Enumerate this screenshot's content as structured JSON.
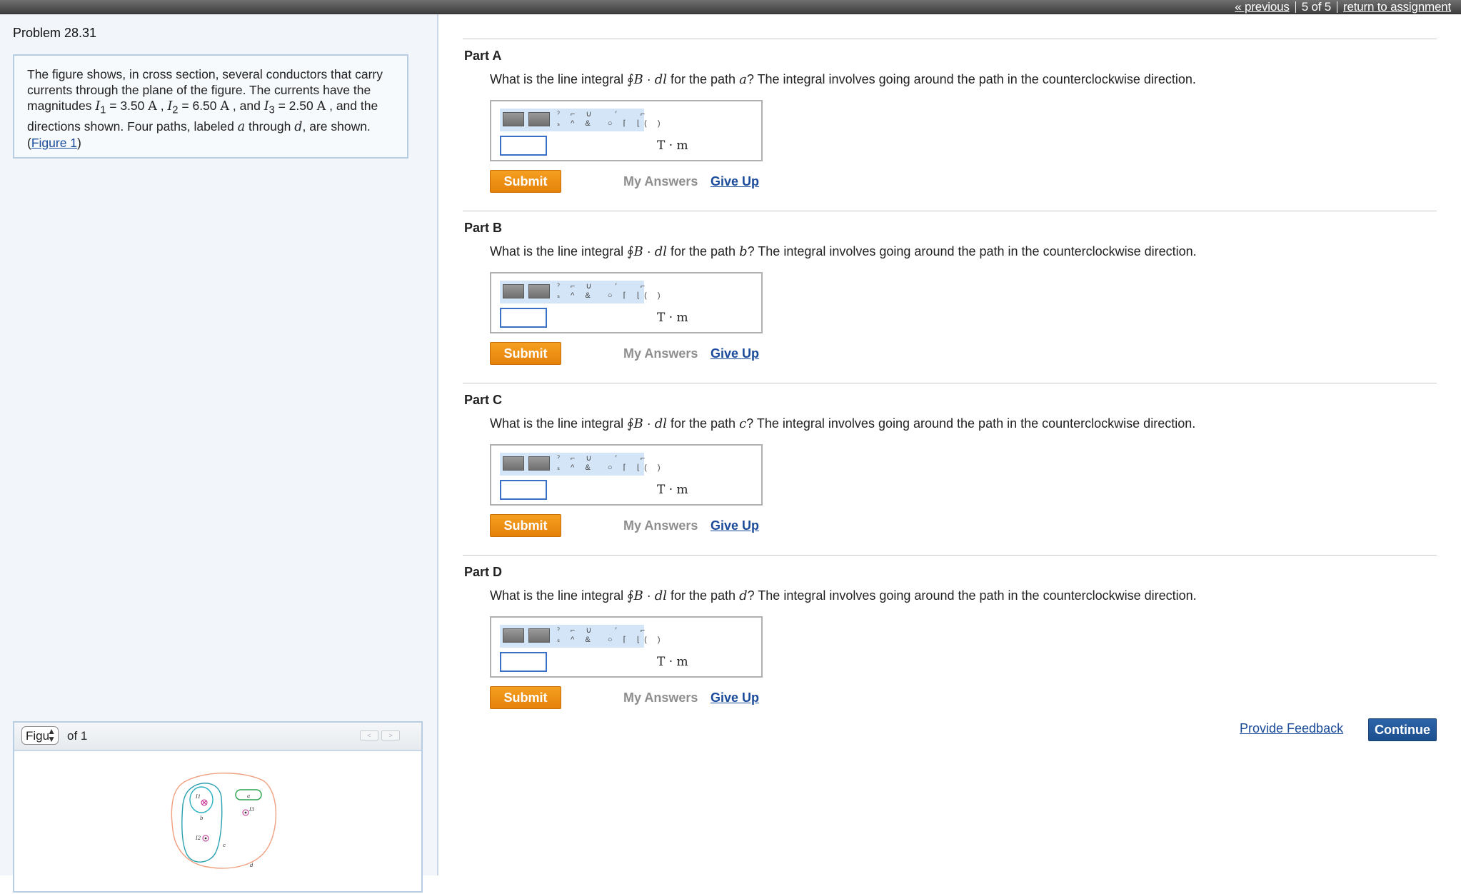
{
  "topnav": {
    "previous": "« previous",
    "position": "5 of 5",
    "return": "return to assignment"
  },
  "problem": {
    "title": "Problem 28.31",
    "statement": {
      "t1": "The figure shows, in cross section, several conductors that carry currents through the plane of the figure. The currents have the magnitudes ",
      "i1_sym": "I",
      "i1_sub": "1",
      "i1_val": " = 3.50 ",
      "amp": "A",
      "t2": " , ",
      "i2_sym": "I",
      "i2_sub": "2",
      "i2_val": " = 6.50 ",
      "t3": " , and ",
      "i3_sym": "I",
      "i3_sub": "3",
      "i3_val": " = 2.50 ",
      "t4": " , and the directions shown. Four paths, labeled ",
      "path_a": "a",
      "t5": " through ",
      "path_d": "d",
      "t6": ", are shown.",
      "fig_open": "(",
      "fig_link": "Figure 1",
      "fig_close": ")"
    }
  },
  "figure_panel": {
    "select_value": "Figu",
    "of_text": "of 1",
    "prev": "<",
    "next": ">",
    "labels": {
      "i1": "I1",
      "i2": "I2",
      "i3": "I3",
      "a": "a",
      "b": "b",
      "c": "c",
      "d": "d"
    }
  },
  "colors": {
    "submit": "#f0901a",
    "link": "#1a4a9a",
    "continue": "#1f5597",
    "path_a": "#2aa04a",
    "path_b": "#2ab0c0",
    "path_c": "#2aa0b0",
    "path_d": "#f0a080",
    "current_marker": "#c0208a"
  },
  "question_parts": {
    "q_prefix": "What is the line integral ",
    "q_integral": "∮",
    "q_B": "B",
    "q_dot": " · ",
    "q_dl": "dl",
    "q_mid": " for the path ",
    "q_suffix": "? The integral involves going around the path in the counterclockwise direction.",
    "unit": "T · m",
    "submit": "Submit",
    "my_answers": "My Answers",
    "give_up": "Give Up"
  },
  "parts": [
    {
      "title": "Part A",
      "path": "a",
      "answer": ""
    },
    {
      "title": "Part B",
      "path": "b",
      "answer": ""
    },
    {
      "title": "Part C",
      "path": "c",
      "answer": ""
    },
    {
      "title": "Part D",
      "path": "d",
      "answer": ""
    }
  ],
  "footer": {
    "feedback": "Provide Feedback",
    "continue": "Continue"
  }
}
